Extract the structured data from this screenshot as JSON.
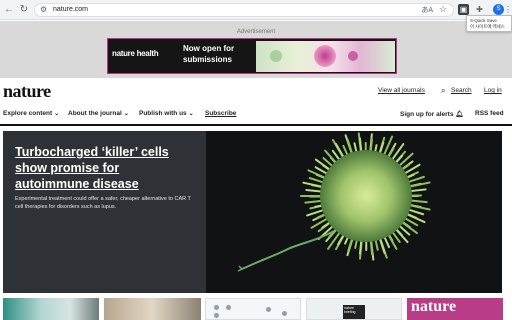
{
  "browser": {
    "url": "nature.com",
    "ab_icon": "あA",
    "star_icon": "☆",
    "avatar_letter": "S",
    "tooltip": {
      "line1": "S-Quick Save",
      "line2": "이 사이트에 엑세스"
    }
  },
  "ad": {
    "label": "Advertisement",
    "brand": "nature health",
    "headline": "Now open for submissions"
  },
  "header": {
    "logo": "nature",
    "view_all": "View all journals",
    "search": "Search",
    "login": "Log in",
    "nav": {
      "explore": "Explore content",
      "about": "About the journal",
      "publish": "Publish with us",
      "subscribe": "Subscribe",
      "alerts": "Sign up for alerts",
      "rss": "RSS feed"
    }
  },
  "hero": {
    "title": "Turbocharged ‘killer’ cells show promise for autoimmune disease",
    "description": "Experimental treatment could offer a safer, cheaper alternative to CAR T cell therapies for disorders such as lupus."
  },
  "strip": {
    "card3_label": "nature briefing",
    "card5_text": "nature"
  },
  "colors": {
    "accent": "#c0348b",
    "hero_bg": "#2e3236",
    "cell": "#9fc36a"
  }
}
